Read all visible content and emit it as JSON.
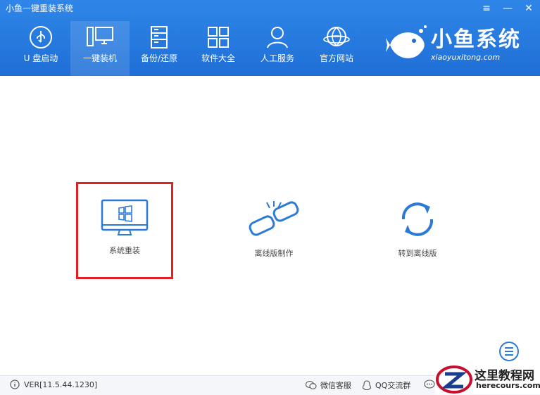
{
  "window": {
    "title": "小鱼一键重装系统",
    "controls": [
      "≡",
      "—",
      "✕"
    ]
  },
  "nav": [
    {
      "label": "U 盘启动",
      "icon": "usb-icon"
    },
    {
      "label": "一键装机",
      "icon": "computer-icon",
      "active": true
    },
    {
      "label": "备份/还原",
      "icon": "backup-icon"
    },
    {
      "label": "软件大全",
      "icon": "apps-grid-icon"
    },
    {
      "label": "人工服务",
      "icon": "person-icon"
    },
    {
      "label": "官方网站",
      "icon": "globe-icon"
    }
  ],
  "brand": {
    "name": "小鱼系统",
    "url": "xiaoyuxitong.com"
  },
  "tiles": [
    {
      "label": "系统重装",
      "icon": "windows-monitor-icon",
      "selected": true
    },
    {
      "label": "离线版制作",
      "icon": "broken-link-icon"
    },
    {
      "label": "转到离线版",
      "icon": "refresh-icon"
    }
  ],
  "footer": {
    "version": "VER[11.5.44.1230]",
    "wechat": "微信客服",
    "qq": "QQ交流群"
  },
  "watermark": {
    "title": "这里教程网",
    "site": "herecours.com"
  },
  "colors": {
    "header": "#1f6fd6",
    "accent_icon": "#2b7ad8",
    "selected_border": "#e02020"
  }
}
